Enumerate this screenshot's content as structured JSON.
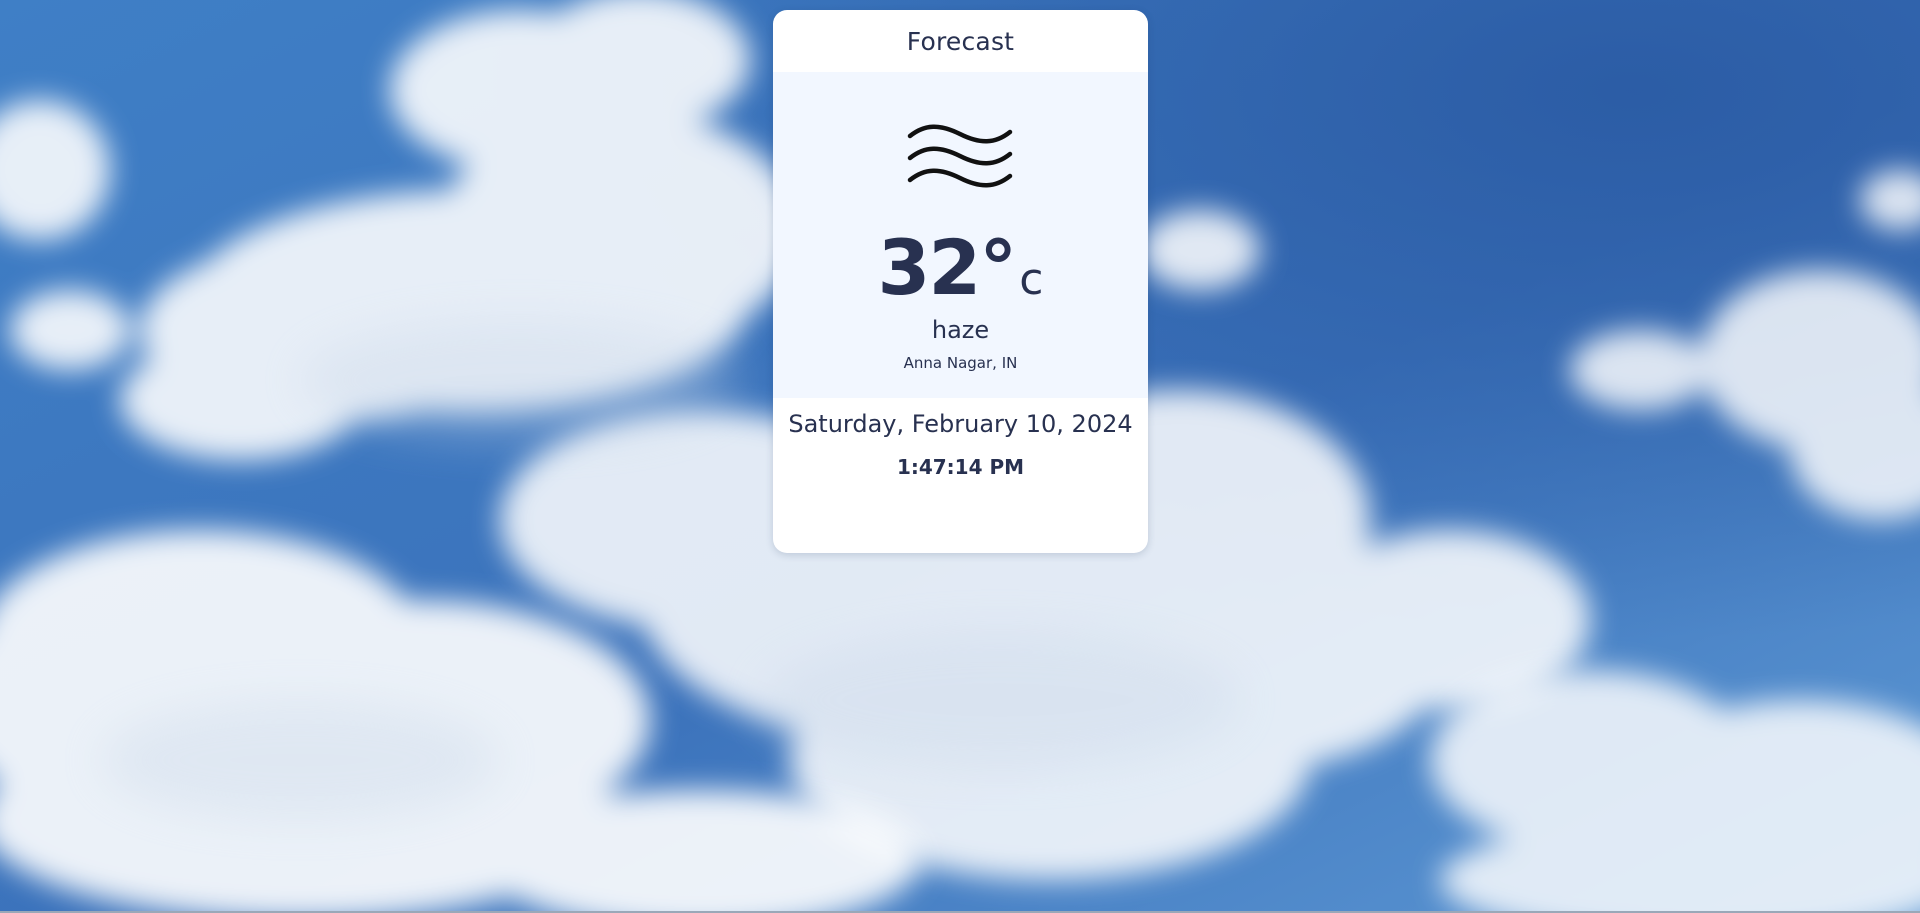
{
  "card": {
    "title": "Forecast",
    "weather_icon": "haze-icon",
    "temperature": "32°",
    "unit": "c",
    "condition": "haze",
    "location": "Anna Nagar, IN",
    "date": "Saturday, February 10, 2024",
    "time": "1:47:14 PM"
  },
  "colors": {
    "text": "#283150",
    "card_background": "#ffffff",
    "current_panel_background": "#f2f7ff",
    "sky_top": "#2f62aa",
    "sky_bottom": "#5f9bd6",
    "cloud": "#ffffff"
  }
}
